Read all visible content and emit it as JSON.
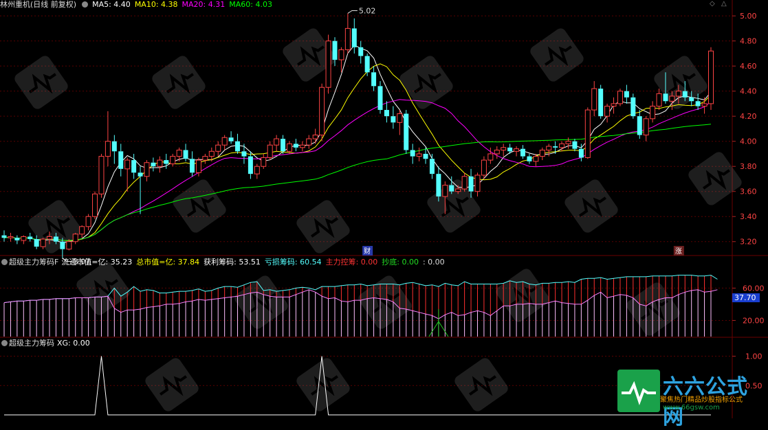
{
  "header1": {
    "title": "林州重机(日线 前复权)",
    "ma5": "MA5: 4.40",
    "ma10": "MA10: 4.38",
    "ma20": "MA20: 4.31",
    "ma60": "MA60: 4.03"
  },
  "header2": {
    "name": "超级主力筹码F",
    "ltsz": "流通市值=亿: 35.23",
    "zsz": "总市值=亿: 37.84",
    "hl": "获利筹码: 53.51",
    "ks": "亏损筹码: 60.54",
    "zlkp": "主力控筹: 0.00",
    "cd": "抄底: 0.00",
    "extra": ": 0.00"
  },
  "header3": {
    "name": "超级主力筹码",
    "xg": "XG: 0.00"
  },
  "annotations": {
    "high": "5.02",
    "low": "3.07",
    "cai": "财",
    "zhang": "涨",
    "ind_value": "37.70"
  },
  "watermark": {
    "line1": "六六公式网",
    "line2": "聚焦热门精品炒股指标公式",
    "line3": "www.66gsw.com"
  },
  "colors": {
    "up": "#ff4444",
    "down": "#54ffff",
    "ma5": "#ffffff",
    "ma10": "#ffff00",
    "ma20": "#ff00ff",
    "ma60": "#00ff00"
  },
  "chart_data": [
    {
      "type": "candlestick",
      "ylim": [
        3.1,
        5.05
      ],
      "yticks": [
        "5.00",
        "4.80",
        "4.60",
        "4.40",
        "4.20",
        "4.00",
        "3.80",
        "3.60",
        "3.40",
        "3.20"
      ],
      "ohlc": [
        [
          3.25,
          3.29,
          3.2,
          3.23
        ],
        [
          3.23,
          3.27,
          3.2,
          3.24
        ],
        [
          3.23,
          3.25,
          3.18,
          3.21
        ],
        [
          3.21,
          3.25,
          3.18,
          3.24
        ],
        [
          3.24,
          3.27,
          3.2,
          3.22
        ],
        [
          3.22,
          3.25,
          3.14,
          3.16
        ],
        [
          3.16,
          3.23,
          3.14,
          3.22
        ],
        [
          3.22,
          3.28,
          3.18,
          3.24
        ],
        [
          3.24,
          3.27,
          3.18,
          3.2
        ],
        [
          3.2,
          3.23,
          3.07,
          3.14
        ],
        [
          3.14,
          3.22,
          3.13,
          3.2
        ],
        [
          3.2,
          3.27,
          3.18,
          3.26
        ],
        [
          3.26,
          3.33,
          3.23,
          3.32
        ],
        [
          3.32,
          3.42,
          3.29,
          3.4
        ],
        [
          3.4,
          3.6,
          3.38,
          3.58
        ],
        [
          3.58,
          3.9,
          3.55,
          3.88
        ],
        [
          3.88,
          4.24,
          3.8,
          4.0
        ],
        [
          4.0,
          4.05,
          3.82,
          3.92
        ],
        [
          3.92,
          3.98,
          3.72,
          3.78
        ],
        [
          3.78,
          3.87,
          3.6,
          3.85
        ],
        [
          3.85,
          3.9,
          3.7,
          3.75
        ],
        [
          3.75,
          3.8,
          3.42,
          3.72
        ],
        [
          3.72,
          3.85,
          3.68,
          3.83
        ],
        [
          3.83,
          3.87,
          3.76,
          3.8
        ],
        [
          3.8,
          3.88,
          3.75,
          3.85
        ],
        [
          3.85,
          3.9,
          3.78,
          3.82
        ],
        [
          3.82,
          3.9,
          3.8,
          3.88
        ],
        [
          3.88,
          3.95,
          3.84,
          3.93
        ],
        [
          3.93,
          3.98,
          3.84,
          3.86
        ],
        [
          3.86,
          3.92,
          3.72,
          3.75
        ],
        [
          3.75,
          3.87,
          3.72,
          3.85
        ],
        [
          3.85,
          3.9,
          3.82,
          3.88
        ],
        [
          3.88,
          3.95,
          3.84,
          3.92
        ],
        [
          3.92,
          4.0,
          3.88,
          3.97
        ],
        [
          3.97,
          4.05,
          3.93,
          4.03
        ],
        [
          4.03,
          4.08,
          3.98,
          4.0
        ],
        [
          4.0,
          4.06,
          3.9,
          3.92
        ],
        [
          3.92,
          3.98,
          3.82,
          3.88
        ],
        [
          3.88,
          3.92,
          3.7,
          3.74
        ],
        [
          3.74,
          3.82,
          3.7,
          3.8
        ],
        [
          3.8,
          3.9,
          3.78,
          3.87
        ],
        [
          3.87,
          4.0,
          3.85,
          3.97
        ],
        [
          3.97,
          4.05,
          3.92,
          4.02
        ],
        [
          4.02,
          4.05,
          3.9,
          3.92
        ],
        [
          3.92,
          4.0,
          3.9,
          3.98
        ],
        [
          3.98,
          4.02,
          3.92,
          3.95
        ],
        [
          3.95,
          4.0,
          3.92,
          3.97
        ],
        [
          3.97,
          4.05,
          3.94,
          4.02
        ],
        [
          4.02,
          4.1,
          3.98,
          4.05
        ],
        [
          4.05,
          4.46,
          4.0,
          4.43
        ],
        [
          4.43,
          4.85,
          4.38,
          4.8
        ],
        [
          4.8,
          4.83,
          4.6,
          4.65
        ],
        [
          4.65,
          4.75,
          4.55,
          4.73
        ],
        [
          4.73,
          5.02,
          4.7,
          4.9
        ],
        [
          4.9,
          4.98,
          4.7,
          4.75
        ],
        [
          4.75,
          4.8,
          4.62,
          4.68
        ],
        [
          4.68,
          4.7,
          4.52,
          4.55
        ],
        [
          4.55,
          4.6,
          4.4,
          4.44
        ],
        [
          4.44,
          4.48,
          4.22,
          4.25
        ],
        [
          4.25,
          4.32,
          4.15,
          4.2
        ],
        [
          4.2,
          4.28,
          4.1,
          4.15
        ],
        [
          4.15,
          4.25,
          4.05,
          4.22
        ],
        [
          4.22,
          4.25,
          3.9,
          3.93
        ],
        [
          3.93,
          3.98,
          3.82,
          3.88
        ],
        [
          3.88,
          3.95,
          3.84,
          3.9
        ],
        [
          3.9,
          3.95,
          3.82,
          3.86
        ],
        [
          3.86,
          3.9,
          3.7,
          3.74
        ],
        [
          3.74,
          3.8,
          3.52,
          3.56
        ],
        [
          3.56,
          3.68,
          3.42,
          3.65
        ],
        [
          3.65,
          3.72,
          3.58,
          3.6
        ],
        [
          3.6,
          3.65,
          3.58,
          3.62
        ],
        [
          3.62,
          3.75,
          3.6,
          3.72
        ],
        [
          3.72,
          3.78,
          3.55,
          3.6
        ],
        [
          3.6,
          3.75,
          3.56,
          3.73
        ],
        [
          3.73,
          3.88,
          3.7,
          3.85
        ],
        [
          3.85,
          3.95,
          3.82,
          3.9
        ],
        [
          3.9,
          3.96,
          3.86,
          3.93
        ],
        [
          3.93,
          3.98,
          3.88,
          3.95
        ],
        [
          3.95,
          3.98,
          3.9,
          3.92
        ],
        [
          3.92,
          3.96,
          3.88,
          3.94
        ],
        [
          3.94,
          3.97,
          3.86,
          3.88
        ],
        [
          3.88,
          3.9,
          3.82,
          3.84
        ],
        [
          3.84,
          3.9,
          3.8,
          3.88
        ],
        [
          3.88,
          3.95,
          3.85,
          3.93
        ],
        [
          3.93,
          3.98,
          3.88,
          3.96
        ],
        [
          3.96,
          4.0,
          3.9,
          3.95
        ],
        [
          3.95,
          4.0,
          3.92,
          3.98
        ],
        [
          3.98,
          4.03,
          3.94,
          4.0
        ],
        [
          4.0,
          4.02,
          3.92,
          3.94
        ],
        [
          3.94,
          3.98,
          3.84,
          3.87
        ],
        [
          3.87,
          4.27,
          3.86,
          4.25
        ],
        [
          4.25,
          4.48,
          4.2,
          4.42
        ],
        [
          4.42,
          4.45,
          4.18,
          4.2
        ],
        [
          4.2,
          4.3,
          4.15,
          4.28
        ],
        [
          4.28,
          4.35,
          4.22,
          4.3
        ],
        [
          4.3,
          4.42,
          4.28,
          4.4
        ],
        [
          4.4,
          4.45,
          4.3,
          4.35
        ],
        [
          4.35,
          4.38,
          4.18,
          4.2
        ],
        [
          4.2,
          4.25,
          4.02,
          4.05
        ],
        [
          4.05,
          4.2,
          4.0,
          4.18
        ],
        [
          4.18,
          4.32,
          4.15,
          4.28
        ],
        [
          4.28,
          4.42,
          4.25,
          4.38
        ],
        [
          4.38,
          4.55,
          4.3,
          4.32
        ],
        [
          4.32,
          4.4,
          4.25,
          4.36
        ],
        [
          4.36,
          4.45,
          4.3,
          4.4
        ],
        [
          4.4,
          4.48,
          4.32,
          4.35
        ],
        [
          4.35,
          4.4,
          4.28,
          4.32
        ],
        [
          4.32,
          4.38,
          4.25,
          4.28
        ],
        [
          4.28,
          4.35,
          4.22,
          4.3
        ],
        [
          4.3,
          4.75,
          4.25,
          4.72
        ]
      ]
    },
    {
      "type": "line",
      "name": "超级主力筹码F",
      "ylim": [
        0,
        85
      ],
      "yticks": [
        "60.00",
        "20.00"
      ],
      "series": [
        {
          "values": [
            42,
            43,
            44,
            44,
            45,
            45,
            46,
            46,
            47,
            47,
            47,
            48,
            48,
            48,
            49,
            49,
            50,
            60,
            50,
            55,
            62,
            56,
            58,
            57,
            54,
            54,
            55,
            56,
            56,
            57,
            59,
            56,
            57,
            60,
            62,
            62,
            61,
            64,
            67,
            68,
            57,
            58,
            56,
            57,
            58,
            60,
            61,
            60,
            58,
            62,
            62,
            62,
            63,
            64,
            64,
            65,
            63,
            64,
            65,
            65,
            65,
            64,
            66,
            67,
            65,
            63,
            64,
            62,
            66,
            64,
            63,
            68,
            65,
            65,
            65,
            65,
            65,
            66,
            69,
            67,
            68,
            65,
            64,
            66,
            66,
            67,
            67,
            68,
            67,
            71,
            72,
            72,
            73,
            71,
            72,
            73,
            74,
            74,
            74,
            74,
            75,
            75,
            75,
            75,
            76,
            76,
            76,
            75,
            75,
            76,
            71
          ]
        },
        {
          "values": [
            42,
            43,
            44,
            44,
            45,
            45,
            46,
            46,
            47,
            47,
            47,
            48,
            48,
            48,
            49,
            49,
            50,
            35,
            30,
            33,
            33,
            34,
            36,
            37,
            38,
            40,
            40,
            41,
            43,
            44,
            46,
            45,
            46,
            47,
            48,
            49,
            50,
            52,
            54,
            55,
            52,
            50,
            49,
            49,
            49,
            52,
            55,
            58,
            55,
            50,
            47,
            48,
            44,
            43,
            45,
            45,
            47,
            48,
            47,
            46,
            43,
            35,
            34,
            32,
            30,
            28,
            26,
            22,
            27,
            30,
            26,
            27,
            30,
            32,
            30,
            26,
            32,
            38,
            38,
            40,
            40,
            41,
            40,
            40,
            42,
            44,
            42,
            41,
            40,
            40,
            45,
            51,
            55,
            48,
            50,
            52,
            51,
            48,
            40,
            38,
            43,
            46,
            48,
            48,
            52,
            55,
            57,
            58,
            55,
            56,
            58
          ]
        }
      ]
    },
    {
      "type": "line",
      "name": "超级主力筹码 XG",
      "ylim": [
        0,
        1.1
      ],
      "yticks": [
        "1.00",
        "0.50"
      ],
      "series": [
        {
          "values": [
            0,
            0,
            0,
            0,
            0,
            0,
            0,
            0,
            0,
            0,
            0,
            0,
            0,
            0,
            0,
            1,
            0,
            0,
            0,
            0,
            0,
            0,
            0,
            0,
            0,
            0,
            0,
            0,
            0,
            0,
            0,
            0,
            0,
            0,
            0,
            0,
            0,
            0,
            0,
            0,
            0,
            0,
            0,
            0,
            0,
            0,
            0,
            0,
            0,
            1,
            0,
            0,
            0,
            0,
            0,
            0,
            0,
            0,
            0,
            0,
            0,
            0,
            0,
            0,
            0,
            0,
            0,
            0,
            0,
            0,
            0,
            0,
            0,
            0,
            0,
            0,
            0,
            0,
            0,
            0,
            0,
            0,
            0,
            0,
            0,
            0,
            0,
            0,
            0,
            0,
            0,
            0,
            0,
            0,
            0,
            0,
            0,
            0,
            0,
            0,
            0,
            0,
            0,
            0,
            0,
            0,
            0,
            0,
            0,
            0
          ]
        }
      ]
    }
  ]
}
